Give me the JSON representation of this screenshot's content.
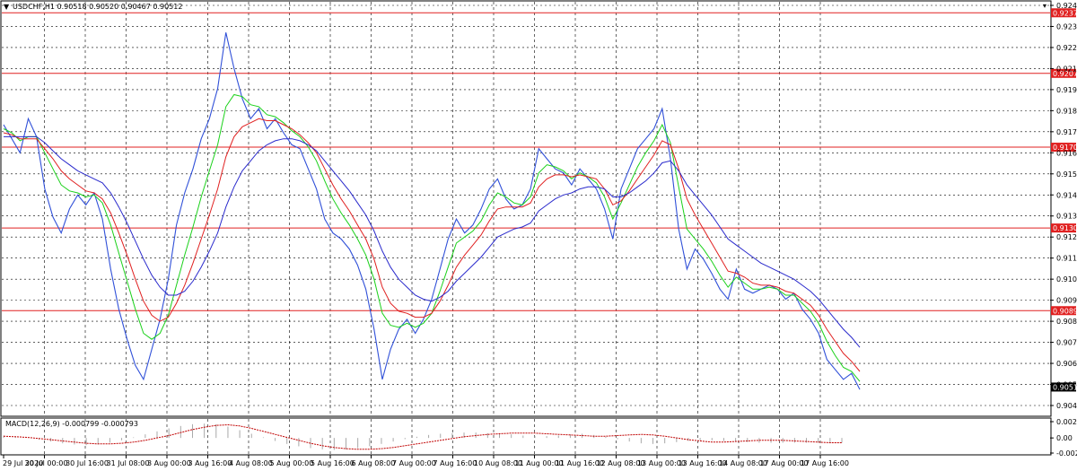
{
  "symbol_header": "USDCHF,H1  0.90518 0.90520 0.90467 0.90512",
  "macd_header": "MACD(12,26,9) -0.000799 -0.000793",
  "colors": {
    "price": "#3050d8",
    "ma_fast": "#1ad11a",
    "ma_mid": "#e02020",
    "ma_slow": "#2a2acc",
    "hline": "#e02020",
    "grid": "#000000",
    "macd_signal": "#c00000",
    "macd_hist": "#a8a8a8"
  },
  "price_axis": {
    "ticks": [
      "0.92415",
      "0.92310",
      "0.92205",
      "0.92100",
      "0.91995",
      "0.91890",
      "0.91785",
      "0.91680",
      "0.91575",
      "0.91470",
      "0.91365",
      "0.91260",
      "0.91155",
      "0.91050",
      "0.90945",
      "0.90840",
      "0.90735",
      "0.90630",
      "0.90525",
      "0.90420"
    ],
    "current_price": "0.90512"
  },
  "horizontal_levels": [
    "0.92378",
    "0.92076",
    "0.91708",
    "0.91305",
    "0.90893"
  ],
  "macd_axis": [
    "0.002725",
    "0.00",
    "-0.00253"
  ],
  "time_axis": [
    "29 Jul 2020",
    "30 Jul 00:00",
    "30 Jul 16:00",
    "31 Jul 08:00",
    "3 Aug 00:00",
    "3 Aug 16:00",
    "4 Aug 08:00",
    "5 Aug 00:00",
    "5 Aug 16:00",
    "6 Aug 08:00",
    "7 Aug 00:00",
    "7 Aug 16:00",
    "10 Aug 08:00",
    "11 Aug 00:00",
    "11 Aug 16:00",
    "12 Aug 08:00",
    "13 Aug 00:00",
    "13 Aug 16:00",
    "14 Aug 08:00",
    "17 Aug 00:00",
    "17 Aug 16:00"
  ],
  "chart_data": {
    "type": "line",
    "series": [
      {
        "values": [
          0.9182,
          0.9175,
          0.9168,
          0.9185,
          0.9176,
          0.915,
          0.9136,
          0.9128,
          0.914,
          0.9147,
          0.9142,
          0.9148,
          0.9135,
          0.911,
          0.909,
          0.9075,
          0.9062,
          0.9055,
          0.907,
          0.9085,
          0.9105,
          0.9132,
          0.9148,
          0.916,
          0.9175,
          0.9185,
          0.92,
          0.9228,
          0.921,
          0.9195,
          0.9185,
          0.919,
          0.918,
          0.9185,
          0.9178,
          0.9172,
          0.917,
          0.916,
          0.915,
          0.9135,
          0.9128,
          0.9125,
          0.912,
          0.9112,
          0.91,
          0.908,
          0.9055,
          0.907,
          0.908,
          0.9085,
          0.9078,
          0.9085,
          0.9095,
          0.911,
          0.9125,
          0.9135,
          0.9128,
          0.9132,
          0.914,
          0.915,
          0.9155,
          0.9145,
          0.914,
          0.9142,
          0.915,
          0.917,
          0.9165,
          0.916,
          0.9158,
          0.9152,
          0.916,
          0.9155,
          0.915,
          0.914,
          0.9125,
          0.915,
          0.916,
          0.917,
          0.9175,
          0.918,
          0.919,
          0.9165,
          0.913,
          0.911,
          0.912,
          0.9115,
          0.9108,
          0.91,
          0.9095,
          0.911,
          0.91,
          0.9098,
          0.91,
          0.9102,
          0.91,
          0.9095,
          0.9098,
          0.909,
          0.9085,
          0.9078,
          0.9065,
          0.906,
          0.9055,
          0.9058,
          0.905
        ]
      },
      {
        "values": [
          0.918,
          0.9178,
          0.9174,
          0.9176,
          0.9176,
          0.9168,
          0.916,
          0.9152,
          0.9149,
          0.9148,
          0.9146,
          0.9147,
          0.9143,
          0.9132,
          0.9118,
          0.9104,
          0.909,
          0.9078,
          0.9075,
          0.9078,
          0.9087,
          0.9102,
          0.9117,
          0.9131,
          0.9146,
          0.9159,
          0.9172,
          0.9191,
          0.9197,
          0.9196,
          0.9192,
          0.9191,
          0.9187,
          0.9186,
          0.9183,
          0.9179,
          0.9176,
          0.9171,
          0.9164,
          0.9154,
          0.9145,
          0.9138,
          0.9132,
          0.9125,
          0.9117,
          0.9105,
          0.9088,
          0.9082,
          0.9081,
          0.9083,
          0.9081,
          0.9083,
          0.9088,
          0.9099,
          0.9111,
          0.9123,
          0.9126,
          0.9129,
          0.9134,
          0.9142,
          0.9148,
          0.9146,
          0.9143,
          0.9142,
          0.9146,
          0.9158,
          0.9162,
          0.9161,
          0.9159,
          0.9155,
          0.9158,
          0.9156,
          0.9153,
          0.9146,
          0.9135,
          0.9143,
          0.9152,
          0.9161,
          0.9168,
          0.9174,
          0.9182,
          0.9173,
          0.9151,
          0.913,
          0.9125,
          0.912,
          0.9114,
          0.9107,
          0.9101,
          0.9106,
          0.9103,
          0.91,
          0.91,
          0.9101,
          0.91,
          0.9097,
          0.9097,
          0.9093,
          0.9089,
          0.9083,
          0.9074,
          0.9067,
          0.9061,
          0.9059,
          0.9054
        ]
      },
      {
        "values": [
          0.9178,
          0.9177,
          0.9175,
          0.9175,
          0.9175,
          0.917,
          0.9165,
          0.9159,
          0.9155,
          0.9152,
          0.9149,
          0.9148,
          0.9145,
          0.9138,
          0.9128,
          0.9117,
          0.9105,
          0.9094,
          0.9087,
          0.9084,
          0.9086,
          0.9093,
          0.9102,
          0.9113,
          0.9125,
          0.9137,
          0.915,
          0.9166,
          0.9176,
          0.9181,
          0.9183,
          0.9185,
          0.9184,
          0.9184,
          0.9182,
          0.918,
          0.9177,
          0.9173,
          0.9168,
          0.916,
          0.9152,
          0.9145,
          0.9139,
          0.9132,
          0.9125,
          0.9115,
          0.9101,
          0.9093,
          0.9089,
          0.9088,
          0.9086,
          0.9086,
          0.9088,
          0.9094,
          0.9102,
          0.9111,
          0.9117,
          0.9122,
          0.9127,
          0.9134,
          0.914,
          0.9141,
          0.9141,
          0.9141,
          0.9143,
          0.9151,
          0.9155,
          0.9157,
          0.9157,
          0.9156,
          0.9157,
          0.9156,
          0.9155,
          0.915,
          0.9142,
          0.9144,
          0.9149,
          0.9155,
          0.9161,
          0.9167,
          0.9174,
          0.9172,
          0.916,
          0.9145,
          0.9137,
          0.913,
          0.9123,
          0.9116,
          0.9109,
          0.9108,
          0.9106,
          0.9103,
          0.9102,
          0.9102,
          0.9101,
          0.9099,
          0.9098,
          0.9095,
          0.9092,
          0.9087,
          0.908,
          0.9074,
          0.9068,
          0.9064,
          0.9059
        ]
      },
      {
        "values": [
          0.9176,
          0.9176,
          0.9176,
          0.9176,
          0.9176,
          0.9173,
          0.9169,
          0.9165,
          0.9162,
          0.9159,
          0.9157,
          0.9155,
          0.9153,
          0.9148,
          0.9141,
          0.9133,
          0.9124,
          0.9115,
          0.9107,
          0.9101,
          0.9097,
          0.9097,
          0.9099,
          0.9104,
          0.9111,
          0.9119,
          0.9128,
          0.9141,
          0.9151,
          0.9159,
          0.9164,
          0.9169,
          0.9172,
          0.9174,
          0.9175,
          0.9175,
          0.9174,
          0.9172,
          0.9169,
          0.9164,
          0.9159,
          0.9154,
          0.9149,
          0.9143,
          0.9137,
          0.9129,
          0.9119,
          0.9111,
          0.9105,
          0.9101,
          0.9097,
          0.9095,
          0.9094,
          0.9096,
          0.9099,
          0.9104,
          0.9108,
          0.9112,
          0.9116,
          0.9121,
          0.9126,
          0.9128,
          0.913,
          0.9131,
          0.9133,
          0.9139,
          0.9142,
          0.9145,
          0.9147,
          0.9148,
          0.915,
          0.9151,
          0.9151,
          0.915,
          0.9146,
          0.9146,
          0.9148,
          0.9151,
          0.9154,
          0.9158,
          0.9163,
          0.9164,
          0.9159,
          0.9152,
          0.9147,
          0.9142,
          0.9137,
          0.9131,
          0.9125,
          0.9122,
          0.9119,
          0.9116,
          0.9113,
          0.9111,
          0.9109,
          0.9107,
          0.9105,
          0.9102,
          0.9099,
          0.9095,
          0.909,
          0.9085,
          0.908,
          0.9076,
          0.9071
        ]
      }
    ],
    "ylim": [
      0.9042,
      0.92415
    ]
  },
  "macd_data": {
    "signal": [
      0.0003,
      0.0002,
      0.0001,
      -0.0001,
      -0.0003,
      -0.0005,
      -0.0007,
      -0.0009,
      -0.001,
      -0.001,
      -0.0009,
      -0.0007,
      -0.0004,
      0.0,
      0.0004,
      0.0009,
      0.0014,
      0.0018,
      0.0021,
      0.0022,
      0.002,
      0.0016,
      0.0011,
      0.0006,
      0.0001,
      -0.0004,
      -0.0009,
      -0.0013,
      -0.0016,
      -0.0018,
      -0.0019,
      -0.0019,
      -0.0018,
      -0.0016,
      -0.0013,
      -0.001,
      -0.0007,
      -0.0004,
      -0.0001,
      0.0002,
      0.0004,
      0.0006,
      0.0007,
      0.0008,
      0.0008,
      0.0008,
      0.0007,
      0.0006,
      0.0005,
      0.0004,
      0.0003,
      0.0003,
      0.0004,
      0.0005,
      0.0006,
      0.0005,
      0.0003,
      0.0,
      -0.0003,
      -0.0005,
      -0.0007,
      -0.0007,
      -0.0006,
      -0.0005,
      -0.0004,
      -0.0004,
      -0.0004,
      -0.0005,
      -0.0006,
      -0.0007,
      -0.0008,
      -0.0008
    ],
    "hist": [
      0.0004,
      0.0002,
      0.0,
      -0.0003,
      -0.0006,
      -0.0009,
      -0.0011,
      -0.0012,
      -0.0011,
      -0.0008,
      -0.0004,
      0.0001,
      0.0006,
      0.0011,
      0.0016,
      0.002,
      0.0023,
      0.0024,
      0.0023,
      0.0019,
      0.0013,
      0.0007,
      0.0001,
      -0.0005,
      -0.001,
      -0.0014,
      -0.0017,
      -0.0019,
      -0.002,
      -0.0019,
      -0.0017,
      -0.0014,
      -0.001,
      -0.0006,
      -0.0002,
      0.0002,
      0.0005,
      0.0007,
      0.0008,
      0.0009,
      0.0009,
      0.0008,
      0.0007,
      0.0006,
      0.0004,
      0.0003,
      0.0003,
      0.0004,
      0.0006,
      0.0007,
      0.0005,
      0.0002,
      -0.0002,
      -0.0006,
      -0.0009,
      -0.001,
      -0.0009,
      -0.0007,
      -0.0005,
      -0.0004,
      -0.0004,
      -0.0005,
      -0.0006,
      -0.0007,
      -0.0008,
      -0.0008,
      -0.0008,
      -0.0008,
      -0.0008,
      -0.0008,
      -0.0008,
      -0.0008
    ],
    "ylim": [
      -0.00253,
      0.002725
    ]
  }
}
